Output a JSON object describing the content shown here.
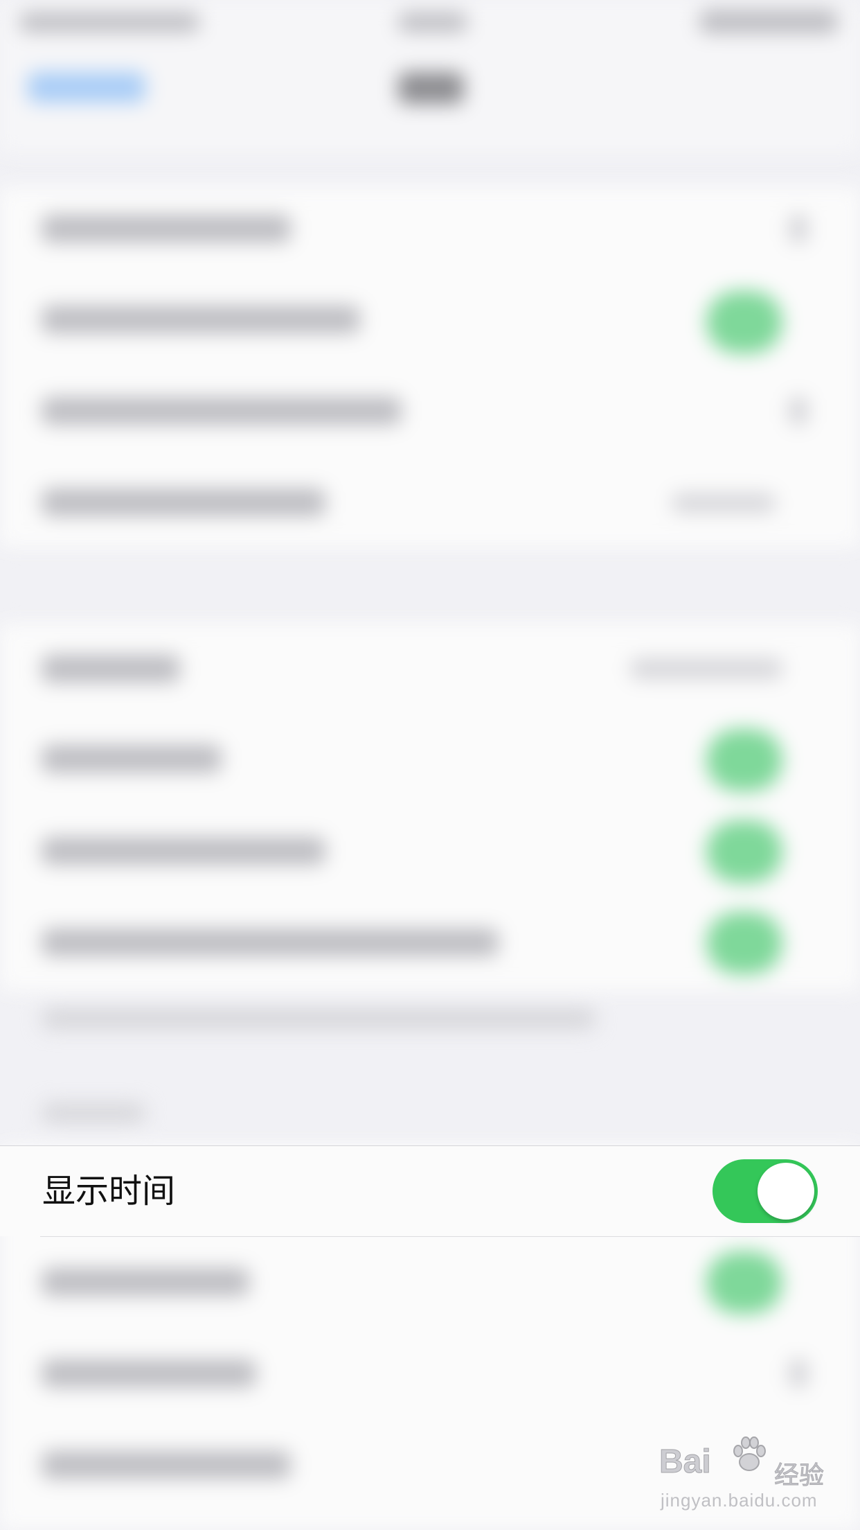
{
  "focused_setting": {
    "label": "显示时间",
    "enabled": true
  },
  "colors": {
    "toggle_on": "#34c759",
    "blurred_toggle": "#7fd89a",
    "nav_tint": "#a9cdf7"
  },
  "icons": {
    "watermark_logo": "paw-icon"
  },
  "watermark": {
    "logo": "Bai",
    "logo_suffix": "经验",
    "url": "jingyan.baidu.com"
  }
}
